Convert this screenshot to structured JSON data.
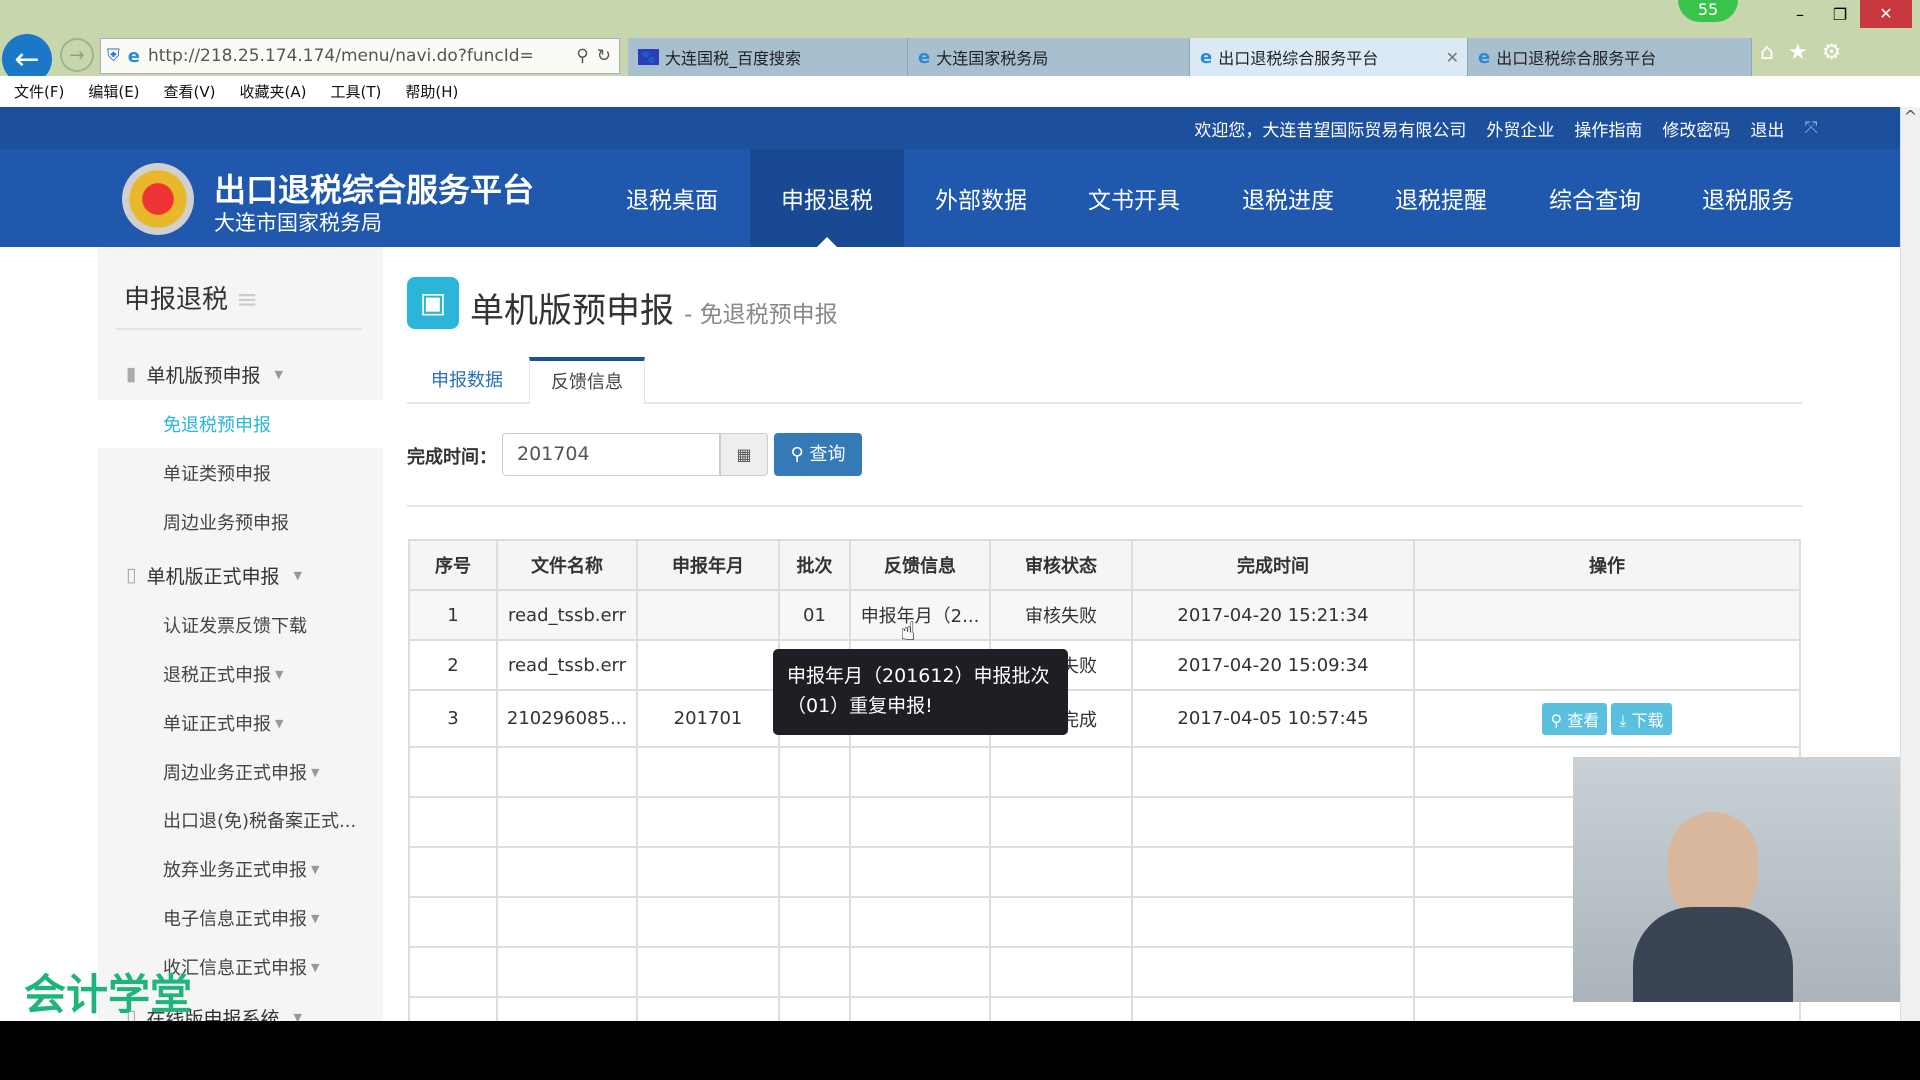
{
  "browser": {
    "url": "http://218.25.174.174/menu/navi.do?funcId=",
    "badge": "55",
    "tabs": [
      {
        "label": "大连国税_百度搜索"
      },
      {
        "label": "大连国家税务局"
      },
      {
        "label": "出口退税综合服务平台",
        "active": true
      },
      {
        "label": "出口退税综合服务平台"
      }
    ],
    "menu": [
      "文件(F)",
      "编辑(E)",
      "查看(V)",
      "收藏夹(A)",
      "工具(T)",
      "帮助(H)"
    ]
  },
  "header": {
    "welcome": "欢迎您，大连昔望国际贸易有限公司",
    "links": [
      "外贸企业",
      "操作指南",
      "修改密码",
      "退出"
    ],
    "title": "出口退税综合服务平台",
    "subtitle": "大连市国家税务局",
    "nav": [
      "退税桌面",
      "申报退税",
      "外部数据",
      "文书开具",
      "退税进度",
      "退税提醒",
      "综合查询",
      "退税服务"
    ],
    "active_nav": 1
  },
  "sidebar": {
    "title": "申报退税",
    "items": [
      {
        "label": "单机版预申报",
        "group": true,
        "icon": "briefcase-icon"
      },
      {
        "label": "免退税预申报",
        "active": true
      },
      {
        "label": "单证类预申报"
      },
      {
        "label": "周边业务预申报"
      },
      {
        "label": "单机版正式申报",
        "group": true,
        "icon": "document-icon"
      },
      {
        "label": "认证发票反馈下载"
      },
      {
        "label": "退税正式申报",
        "caret": true
      },
      {
        "label": "单证正式申报",
        "caret": true
      },
      {
        "label": "周边业务正式申报",
        "caret": true
      },
      {
        "label": "出口退(免)税备案正式..."
      },
      {
        "label": "放弃业务正式申报",
        "caret": true
      },
      {
        "label": "电子信息正式申报",
        "caret": true
      },
      {
        "label": "收汇信息正式申报",
        "caret": true
      },
      {
        "label": "在线版申报系统",
        "group": true,
        "icon": "document-icon"
      }
    ]
  },
  "page": {
    "title": "单机版预申报",
    "subtitle": "- 免退税预申报",
    "tabs": [
      "申报数据",
      "反馈信息"
    ],
    "active_tab": 1,
    "filter": {
      "label": "完成时间：",
      "value": "201704",
      "query": "查询"
    }
  },
  "table": {
    "headers": [
      "序号",
      "文件名称",
      "申报年月",
      "批次",
      "反馈信息",
      "审核状态",
      "完成时间",
      "操作"
    ],
    "rows": [
      [
        "1",
        "read_tssb.err",
        "",
        "01",
        "申报年月（2...",
        "审核失败",
        "2017-04-20 15:21:34",
        ""
      ],
      [
        "2",
        "read_tssb.err",
        "",
        "",
        "",
        "审核失败",
        "2017-04-20 15:09:34",
        ""
      ],
      [
        "3",
        "210296085...",
        "201701",
        "",
        "",
        "审核完成",
        "2017-04-05 10:57:45",
        ""
      ]
    ],
    "actions": {
      "view": "查看",
      "download": "下载"
    }
  },
  "tooltip": "申报年月（201612）申报批次（01）重复申报!",
  "watermark": "会计学堂",
  "colors": {
    "nav": "#2058ad",
    "topbar": "#1c4f9c",
    "accent": "#29b6d8",
    "button": "#337ab7"
  }
}
